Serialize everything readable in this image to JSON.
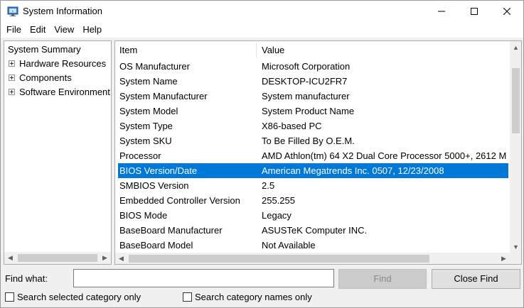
{
  "window": {
    "title": "System Information"
  },
  "menu": [
    "File",
    "Edit",
    "View",
    "Help"
  ],
  "tree": {
    "root": "System Summary",
    "children": [
      "Hardware Resources",
      "Components",
      "Software Environment"
    ]
  },
  "list": {
    "columns": [
      "Item",
      "Value"
    ],
    "rows": [
      {
        "item": "OS Manufacturer",
        "value": "Microsoft Corporation"
      },
      {
        "item": "System Name",
        "value": "DESKTOP-ICU2FR7"
      },
      {
        "item": "System Manufacturer",
        "value": "System manufacturer"
      },
      {
        "item": "System Model",
        "value": "System Product Name"
      },
      {
        "item": "System Type",
        "value": "X86-based PC"
      },
      {
        "item": "System SKU",
        "value": "To Be Filled By O.E.M."
      },
      {
        "item": "Processor",
        "value": "AMD Athlon(tm) 64 X2 Dual Core Processor 5000+, 2612 M"
      },
      {
        "item": "BIOS Version/Date",
        "value": "American Megatrends Inc. 0507, 12/23/2008"
      },
      {
        "item": "SMBIOS Version",
        "value": "2.5"
      },
      {
        "item": "Embedded Controller Version",
        "value": "255.255"
      },
      {
        "item": "BIOS Mode",
        "value": "Legacy"
      },
      {
        "item": "BaseBoard Manufacturer",
        "value": "ASUSTeK Computer INC."
      },
      {
        "item": "BaseBoard Model",
        "value": "Not Available"
      }
    ],
    "selected_index": 7
  },
  "find": {
    "label": "Find what:",
    "value": "",
    "find_button": "Find",
    "close_button": "Close Find",
    "check_selected": "Search selected category only",
    "check_names": "Search category names only"
  },
  "colors": {
    "selection": "#0078d7",
    "title_bar": "#ffffff"
  },
  "icons": [
    "system-information-icon",
    "minimize-icon",
    "maximize-icon",
    "close-icon"
  ]
}
